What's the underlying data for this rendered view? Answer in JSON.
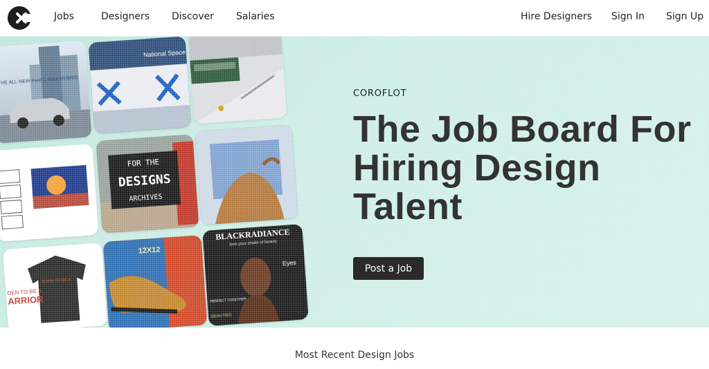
{
  "nav": {
    "logo_icon": "coroflot-logo-icon",
    "left": [
      "Jobs",
      "Designers",
      "Discover",
      "Salaries"
    ],
    "right": [
      "Hire Designers",
      "Sign In",
      "Sign Up"
    ]
  },
  "hero": {
    "eyebrow": "COROFLOT",
    "headline": [
      "The Job Board For",
      "Hiring Design",
      "Talent"
    ],
    "cta": "Post a Job",
    "background": "#cdeee6",
    "button_color": "#2a2a2a"
  },
  "tiles": {
    "car": {
      "text": "THE ALL-NEW Ford C-MAX HYBRID"
    },
    "expo": {
      "text": "National Space"
    },
    "archive": {
      "lines": [
        "FOR THE",
        "DESIGNS",
        "ARCHIVES"
      ]
    },
    "shirt": {
      "text": "DEN TO BE A",
      "brand": "ARRIOR"
    },
    "shoe": {
      "text": "12X12"
    },
    "magazine": {
      "title": "BLACKRADIANCE",
      "tagline": "love your shade of beauty",
      "eyes": "Eyes",
      "perfect": "PERFECT TOGETHER",
      "beauties": "BEAUTIES"
    }
  },
  "section": {
    "title": "Most Recent Design Jobs"
  }
}
